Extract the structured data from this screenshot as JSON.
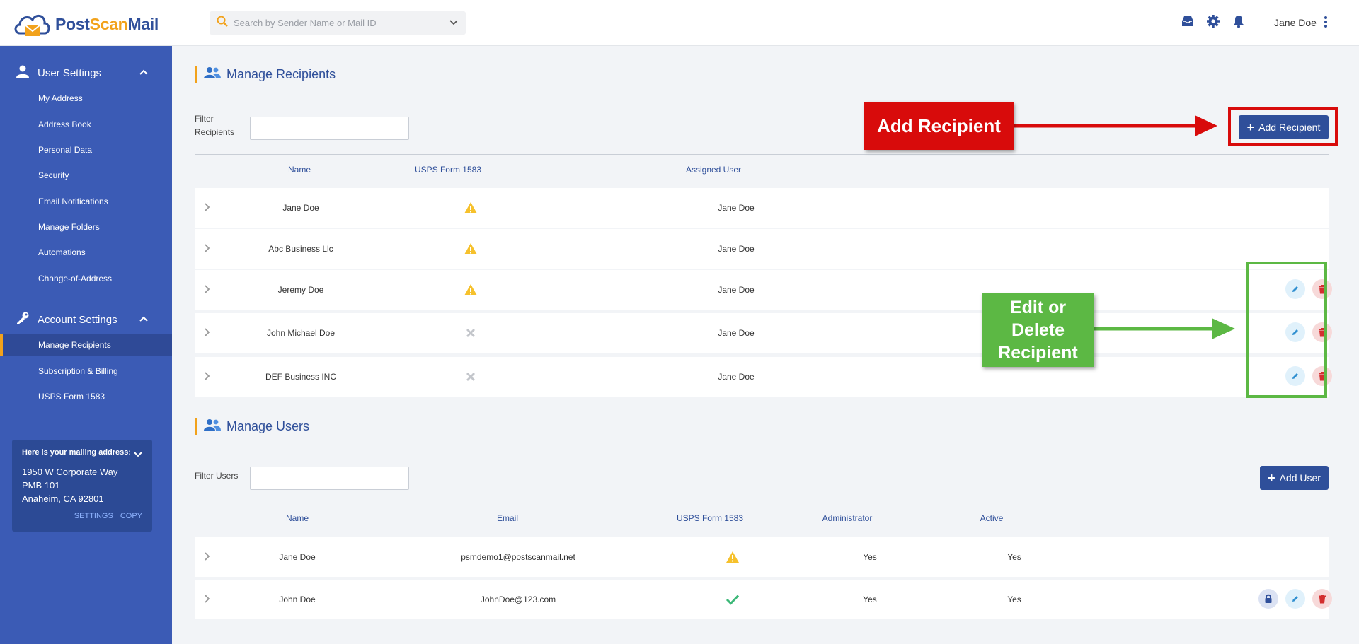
{
  "header": {
    "brand": {
      "part1": "Post",
      "part2": "Scan",
      "part3": "Mail"
    },
    "search_placeholder": "Search by Sender Name or Mail ID",
    "icons": [
      "inbox-icon",
      "gear-icon",
      "bell-icon"
    ],
    "user_name": "Jane Doe"
  },
  "sidebar": {
    "user_settings": {
      "label": "User Settings",
      "items": [
        {
          "label": "My Address"
        },
        {
          "label": "Address Book"
        },
        {
          "label": "Personal Data"
        },
        {
          "label": "Security"
        },
        {
          "label": "Email Notifications"
        },
        {
          "label": "Manage Folders"
        },
        {
          "label": "Automations"
        },
        {
          "label": "Change-of-Address"
        }
      ]
    },
    "account_settings": {
      "label": "Account Settings",
      "items": [
        {
          "label": "Manage Recipients",
          "active": true
        },
        {
          "label": "Subscription & Billing"
        },
        {
          "label": "USPS Form 1583"
        }
      ]
    },
    "mailing_address": {
      "title": "Here is your mailing address:",
      "line1": "1950 W Corporate Way",
      "line2": "PMB 101",
      "line3": "Anaheim, CA 92801",
      "settings_label": "SETTINGS",
      "copy_label": "COPY"
    }
  },
  "recipients": {
    "title": "Manage Recipients",
    "filter_label": "Filter Recipients",
    "add_button": "Add Recipient",
    "columns": {
      "name": "Name",
      "form": "USPS Form 1583",
      "assigned": "Assigned User"
    },
    "rows": [
      {
        "name": "Jane Doe",
        "form_status": "warning",
        "assigned": "Jane Doe",
        "actions": false
      },
      {
        "name": "Abc Business Llc",
        "form_status": "warning",
        "assigned": "Jane Doe",
        "actions": false
      },
      {
        "name": "Jeremy Doe",
        "form_status": "warning",
        "assigned": "Jane Doe",
        "actions": true
      },
      {
        "name": "John Michael Doe",
        "form_status": "none",
        "assigned": "Jane Doe",
        "actions": true
      },
      {
        "name": "DEF Business INC",
        "form_status": "none",
        "assigned": "Jane Doe",
        "actions": true
      }
    ]
  },
  "users": {
    "title": "Manage Users",
    "filter_label": "Filter Users",
    "add_button": "Add User",
    "columns": {
      "name": "Name",
      "email": "Email",
      "form": "USPS Form 1583",
      "admin": "Administrator",
      "active": "Active"
    },
    "rows": [
      {
        "name": "Jane Doe",
        "email": "psmdemo1@postscanmail.net",
        "form_status": "warning",
        "admin": "Yes",
        "active": "Yes"
      },
      {
        "name": "John Doe",
        "email": "JohnDoe@123.com",
        "form_status": "ok",
        "admin": "Yes",
        "active": "Yes"
      }
    ]
  },
  "annotations": {
    "add_recipient": "Add Recipient",
    "edit_delete_line1": "Edit or",
    "edit_delete_line2": "Delete",
    "edit_delete_line3": "Recipient"
  },
  "colors": {
    "sidebar": "#3b5bb5",
    "brand_blue": "#2f4f9a",
    "accent_orange": "#f2a21b",
    "warning": "#f6c12c",
    "success": "#3cb878",
    "danger": "#d32f2f",
    "annotation_red": "#d80b0b",
    "annotation_green": "#5cb844"
  }
}
